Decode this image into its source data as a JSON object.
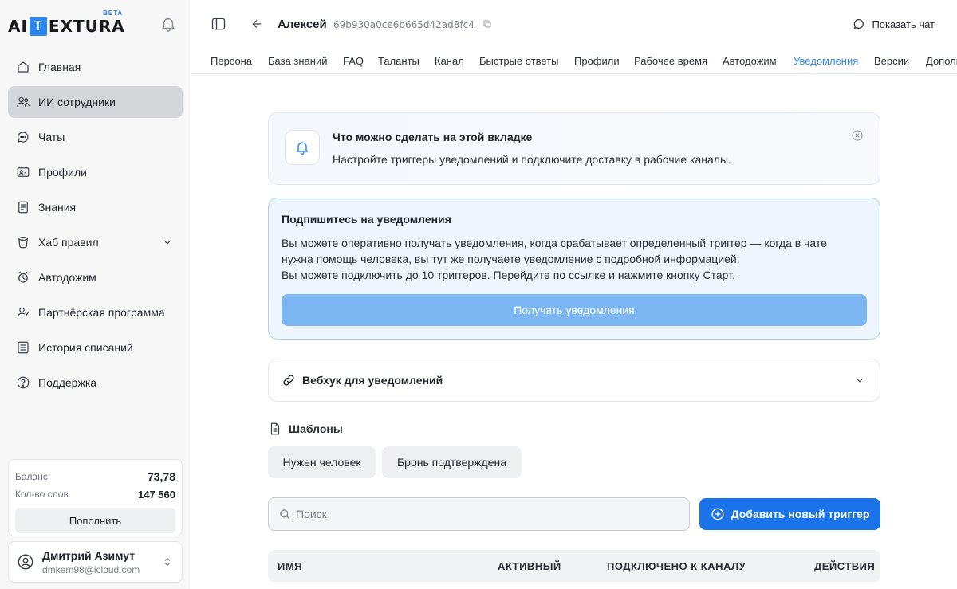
{
  "brand": {
    "logo_left": "AI",
    "logo_box": "T",
    "logo_right": "EXTURA",
    "beta": "BETA"
  },
  "sidebar": {
    "items": [
      {
        "label": "Главная",
        "icon": "home-icon"
      },
      {
        "label": "ИИ сотрудники",
        "icon": "users-icon",
        "active": true
      },
      {
        "label": "Чаты",
        "icon": "chat-icon"
      },
      {
        "label": "Профили",
        "icon": "profile-icon"
      },
      {
        "label": "Знания",
        "icon": "document-icon"
      },
      {
        "label": "Хаб правил",
        "icon": "bucket-icon"
      },
      {
        "label": "Автодожим",
        "icon": "alarm-icon"
      },
      {
        "label": "Партнёрская программа",
        "icon": "partner-icon"
      },
      {
        "label": "История списаний",
        "icon": "list-icon"
      },
      {
        "label": "Поддержка",
        "icon": "help-icon"
      }
    ],
    "balance": {
      "balance_label": "Баланс",
      "balance_value": "73,78",
      "words_label": "Кол-во слов",
      "words_value": "147 560",
      "topup_label": "Пополнить"
    },
    "user": {
      "name": "Дмитрий Азимут",
      "email": "dmkem98@icloud.com"
    }
  },
  "header": {
    "agent_name": "Алексей",
    "agent_id": "69b930a0ce6b665d42ad8fc4",
    "show_chat": "Показать чат"
  },
  "tabs": [
    {
      "label": "Персона"
    },
    {
      "label": "База знаний"
    },
    {
      "label": "FAQ"
    },
    {
      "label": "Таланты"
    },
    {
      "label": "Канал"
    },
    {
      "label": "Быстрые ответы"
    },
    {
      "label": "Профили"
    },
    {
      "label": "Рабочее время"
    },
    {
      "label": "Автодожим"
    },
    {
      "label": "Уведомления",
      "active": true
    },
    {
      "label": "Версии"
    },
    {
      "label": "Дополн"
    }
  ],
  "info": {
    "title": "Что можно сделать на этой вкладке",
    "text": "Настройте триггеры уведомлений и подключите доставку в рабочие каналы."
  },
  "subscribe": {
    "title": "Подпишитесь на уведомления",
    "line1": "Вы можете оперативно получать уведомления, когда срабатывает определенный триггер — когда в чате",
    "line2": "нужна помощь человека, вы тут же получаете уведомление с подробной информацией.",
    "line3": "Вы можете подключить до 10 триггеров. Перейдите по ссылке и нажмите кнопку Старт.",
    "button": "Получать уведомления"
  },
  "webhook": {
    "label": "Вебхук для уведомлений"
  },
  "templates": {
    "title": "Шаблоны",
    "chips": [
      "Нужен человек",
      "Бронь подтверждена"
    ]
  },
  "search": {
    "placeholder": "Поиск",
    "value": ""
  },
  "add_trigger": "Добавить новый триггер",
  "table": {
    "columns": [
      "ИМЯ",
      "АКТИВНЫЙ",
      "ПОДКЛЮЧЕНО К КАНАЛУ",
      "ДЕЙСТВИЯ"
    ]
  },
  "colors": {
    "accent": "#1a73e8",
    "active_tab": "#2e86f0",
    "disabled_button": "#7bb5f2",
    "active_nav_bg": "#d5d6da"
  }
}
